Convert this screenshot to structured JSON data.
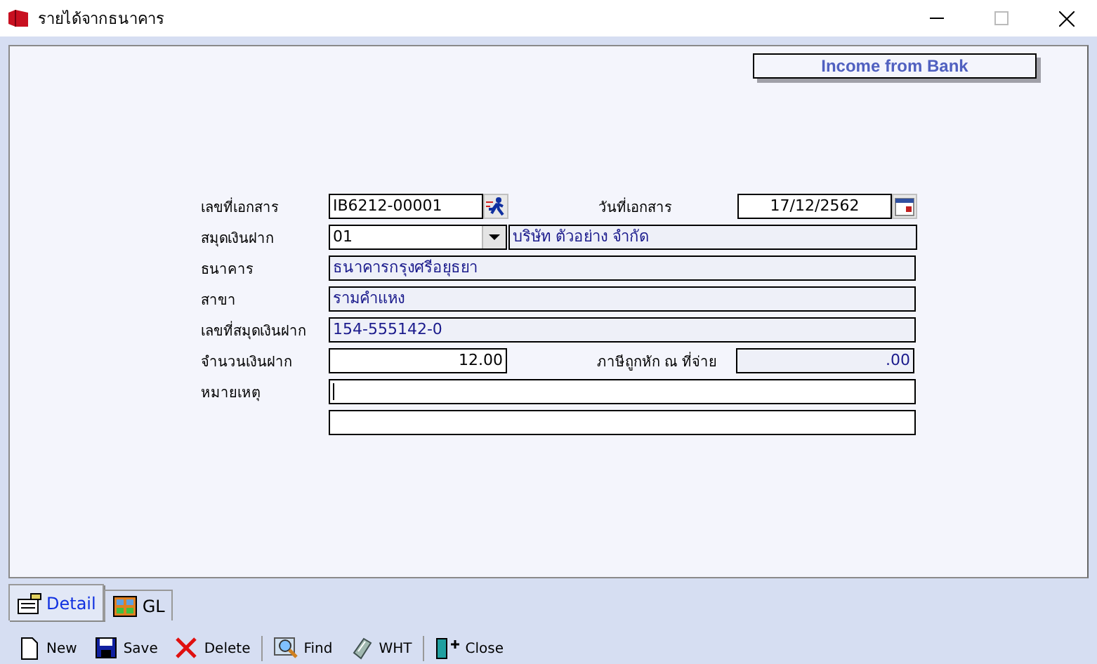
{
  "window": {
    "title": "รายได้จากธนาคาร"
  },
  "form_title": "Income from Bank",
  "rows": [
    {
      "kind": "pair",
      "label": "เลขที่เอกสาร",
      "value": "IB6212-00001",
      "label2": "วันที่เอกสาร",
      "value2": "17/12/2562"
    },
    {
      "kind": "combo",
      "label": "สมุดเงินฝาก",
      "value": "01",
      "value2": "บริษัท ตัวอย่าง จำกัด"
    },
    {
      "kind": "readonly",
      "label": "ธนาคาร",
      "value": "ธนาคารกรุงศรีอยุธยา"
    },
    {
      "kind": "readonly",
      "label": "สาขา",
      "value": "รามคำแหง"
    },
    {
      "kind": "readonly",
      "label": "เลขที่สมุดเงินฝาก",
      "value": "154-555142-0"
    },
    {
      "kind": "amount",
      "label": "จำนวนเงินฝาก",
      "value": "12.00",
      "label2": "ภาษีถูกหัก ณ ที่จ่าย",
      "value2": ".00"
    },
    {
      "kind": "note",
      "label": "หมายเหตุ"
    },
    {
      "kind": "blank"
    }
  ],
  "tabs": [
    {
      "label": "Detail",
      "selected": true
    },
    {
      "label": "GL",
      "selected": false
    }
  ],
  "toolbar": [
    [
      {
        "label": "New"
      },
      {
        "label": "Save"
      },
      {
        "label": "Delete"
      }
    ],
    [
      {
        "label": "Find"
      },
      {
        "label": "WHT"
      }
    ],
    [
      {
        "label": "Close"
      }
    ]
  ]
}
